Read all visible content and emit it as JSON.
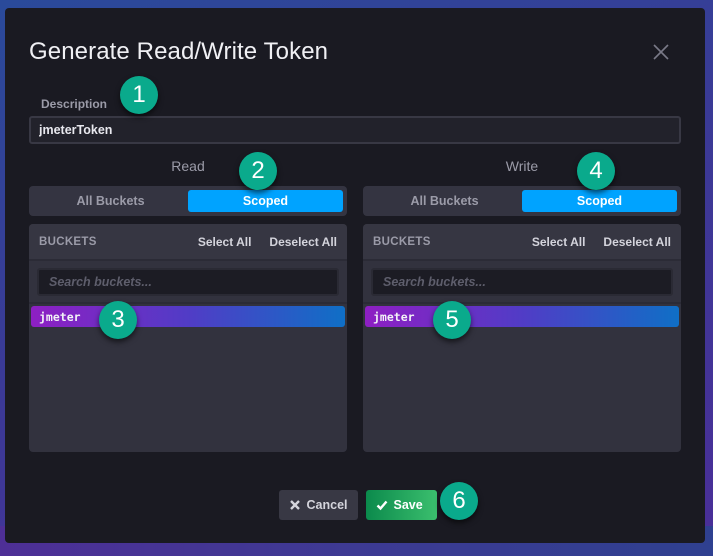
{
  "dialog": {
    "title": "Generate Read/Write Token",
    "close_icon": "close-icon"
  },
  "description": {
    "label": "Description",
    "value": "jmeterToken"
  },
  "read": {
    "title": "Read",
    "toggle": {
      "options": [
        "All Buckets",
        "Scoped"
      ],
      "selected": "Scoped"
    },
    "buckets": {
      "header": "BUCKETS",
      "select_all": "Select All",
      "deselect_all": "Deselect All",
      "search_placeholder": "Search buckets...",
      "items": [
        {
          "name": "jmeter",
          "selected": true
        }
      ]
    }
  },
  "write": {
    "title": "Write",
    "toggle": {
      "options": [
        "All Buckets",
        "Scoped"
      ],
      "selected": "Scoped"
    },
    "buckets": {
      "header": "BUCKETS",
      "select_all": "Select All",
      "deselect_all": "Deselect All",
      "search_placeholder": "Search buckets...",
      "items": [
        {
          "name": "jmeter",
          "selected": true
        }
      ]
    }
  },
  "footer": {
    "cancel_label": "Cancel",
    "cancel_icon": "x-icon",
    "save_label": "Save",
    "save_icon": "checkmark-icon"
  },
  "annotations": [
    "1",
    "2",
    "3",
    "4",
    "5",
    "6"
  ],
  "colors": {
    "accent_blue": "#00a3ff",
    "save_green": "#22a85e",
    "marker_teal": "#0aaa8c",
    "bucket_gradient_start": "#8e1fc3",
    "bucket_gradient_end": "#0f6fc6"
  }
}
